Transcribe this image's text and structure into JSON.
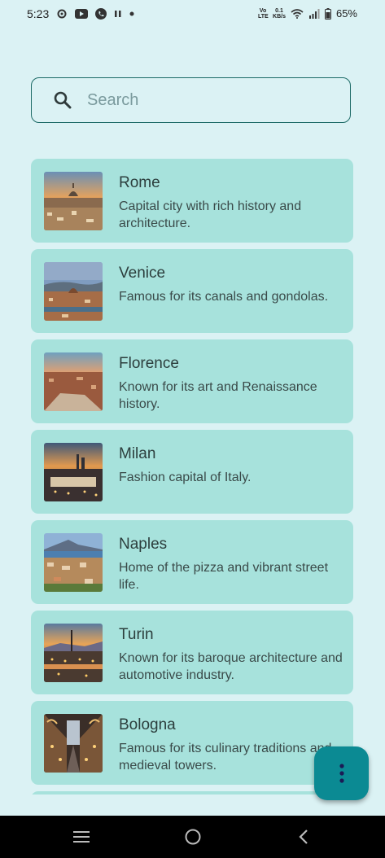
{
  "status_bar": {
    "time": "5:23",
    "left_icons": [
      "settings-icon",
      "youtube-icon",
      "phone-icon",
      "pause-icon",
      "dot-icon"
    ],
    "network_label": "Vo LTE",
    "speed_value": "0.1",
    "speed_unit": "KB/s",
    "battery": "65%"
  },
  "search": {
    "placeholder": "Search",
    "value": ""
  },
  "cities": [
    {
      "name": "Rome",
      "description": "Capital city with rich history and architecture."
    },
    {
      "name": "Venice",
      "description": "Famous for its canals and gondolas."
    },
    {
      "name": "Florence",
      "description": "Known for its art and Renaissance history."
    },
    {
      "name": "Milan",
      "description": "Fashion capital of Italy."
    },
    {
      "name": "Naples",
      "description": "Home of the pizza and vibrant street life."
    },
    {
      "name": "Turin",
      "description": "Known for its baroque architecture and automotive industry."
    },
    {
      "name": "Bologna",
      "description": "Famous for its culinary traditions and medieval towers."
    }
  ],
  "fab": {
    "icon": "more-vertical-icon"
  },
  "nav_bar": {
    "icons": [
      "recent-apps-icon",
      "home-icon",
      "back-icon"
    ]
  },
  "colors": {
    "background": "#dbf2f4",
    "card": "#a7e2dc",
    "fab": "#0b8a93",
    "search_border": "#1d6b67"
  }
}
